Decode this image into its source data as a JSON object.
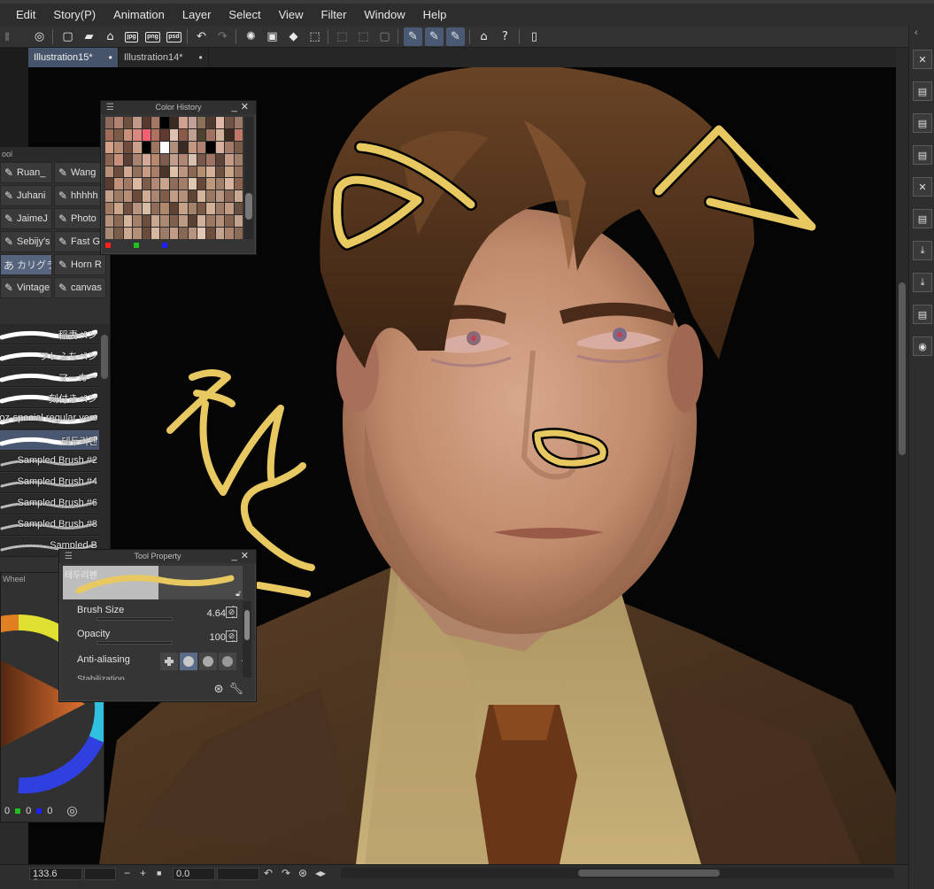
{
  "menu": [
    "Edit",
    "Story(P)",
    "Animation",
    "Layer",
    "Select",
    "View",
    "Filter",
    "Window",
    "Help"
  ],
  "toolbar": {
    "icons": [
      "clip-studio-icon",
      "new-icon",
      "open-icon",
      "save-icon",
      "export-jpg-icon",
      "export-png-icon",
      "export-psd-icon",
      "undo-icon",
      "redo-icon",
      "loading-icon",
      "transform-icon",
      "fill-icon",
      "clear-selection-icon",
      "crop-icon",
      "invert-icon",
      "stabilize-icon",
      "pen-pressure-icon",
      "ruler-icon",
      "learn-icon",
      "help-icon",
      "companion-icon"
    ],
    "mini_labels": {
      "jpg": "jpg",
      "png": "png",
      "psd": "psd"
    }
  },
  "tabs": [
    {
      "label": "Illustration15*",
      "active": true
    },
    {
      "label": "Illustration14*",
      "active": false
    }
  ],
  "color_history": {
    "title": "Color History",
    "swatches": [
      "#8a6a5a",
      "#b08070",
      "#6e5040",
      "#c09a88",
      "#5a3a30",
      "#a47864",
      "#000000",
      "#3a2a20",
      "#d0a090",
      "#c0a098",
      "#8c7058",
      "#4e3a2e",
      "#e0b8a8",
      "#705446",
      "#9a7a66",
      "#a06c58",
      "#7c5a48",
      "#c89078",
      "#d88880",
      "#f06070",
      "#b07060",
      "#603a30",
      "#e0c0b0",
      "#8a5a48",
      "#c0a090",
      "#504030",
      "#a07060",
      "#d0b098",
      "#3a2a20",
      "#c07868",
      "#d4a088",
      "#b88c74",
      "#704c3c",
      "#caa08c",
      "#000000",
      "#9c7460",
      "#ffffff",
      "#b0907c",
      "#3a2a24",
      "#c49880",
      "#b08070",
      "#000000",
      "#d8b0a0",
      "#a27c68",
      "#7a5a48",
      "#8a6450",
      "#c8907c",
      "#5a4034",
      "#a88270",
      "#d4a898",
      "#b88870",
      "#7c5c4c",
      "#c0a08c",
      "#ae8672",
      "#d8c0b0",
      "#785848",
      "#a07464",
      "#5c4438",
      "#c49c88",
      "#a0806c",
      "#b89078",
      "#6c4c3c",
      "#d0a890",
      "#90705c",
      "#c89c84",
      "#a87e68",
      "#4c3428",
      "#e0c0a8",
      "#bc9480",
      "#8c6854",
      "#b49070",
      "#d4b098",
      "#6e5040",
      "#caa488",
      "#987460",
      "#5a3c30",
      "#c09078",
      "#a07864",
      "#d8b8a0",
      "#7c5c48",
      "#b08874",
      "#c8a48c",
      "#8e6e58",
      "#a47c68",
      "#e0c8b0",
      "#684838",
      "#bc987c",
      "#a0806a",
      "#d8b4a0",
      "#8c6450",
      "#c4a08a",
      "#9c7a64",
      "#b88e76",
      "#6a4a38",
      "#d0ac94",
      "#a88670",
      "#7e5e4a",
      "#c29c84",
      "#b4907a",
      "#604434",
      "#d4b49c",
      "#987864",
      "#ba9682",
      "#8a6a56",
      "#c8a890",
      "#a07a60",
      "#cca48a",
      "#705040",
      "#b89480",
      "#d8bca4",
      "#8e6c58",
      "#b0886e",
      "#5e4232",
      "#c6a288",
      "#a4826c",
      "#7a5a46",
      "#d2b098",
      "#9e7c66",
      "#c09a82",
      "#685040",
      "#b6927c",
      "#8a6a54",
      "#d4b49a",
      "#a2806a",
      "#6c4e3e",
      "#c8a690",
      "#aa8872",
      "#7e604c",
      "#bc9a84",
      "#5a4030",
      "#d0b09a",
      "#9a7862",
      "#b48e78",
      "#846450",
      "#c2a28c",
      "#a88a74",
      "#7a5c48",
      "#cca890",
      "#b29078",
      "#6a4c3a",
      "#d6b8a0",
      "#9c7c66",
      "#c09c86",
      "#886852",
      "#b69480",
      "#e2c8b4",
      "#704e3e",
      "#c4a48e",
      "#a8846e",
      "#8c6c58"
    ],
    "foot_colors": [
      "#ff2020",
      "#20c020",
      "#2020ff"
    ]
  },
  "subtool": {
    "header": "ool",
    "items": [
      {
        "label": "Ruan_",
        "icon": "pen-icon",
        "col": 0,
        "row": 0,
        "active": false
      },
      {
        "label": "Wang",
        "icon": "pen-icon",
        "col": 1,
        "row": 0,
        "active": false
      },
      {
        "label": "Juhani",
        "icon": "pen-icon",
        "col": 0,
        "row": 1,
        "active": false
      },
      {
        "label": "hhhhh",
        "icon": "pen-icon",
        "col": 1,
        "row": 1,
        "active": false
      },
      {
        "label": "JaimeJ",
        "icon": "pen-icon",
        "col": 0,
        "row": 2,
        "active": false
      },
      {
        "label": "Photo",
        "icon": "pen-icon",
        "col": 1,
        "row": 2,
        "active": false
      },
      {
        "label": "Sebijy's",
        "icon": "pen-icon",
        "col": 0,
        "row": 3,
        "active": false
      },
      {
        "label": "Fast G",
        "icon": "pen-icon",
        "col": 1,
        "row": 3,
        "active": false
      },
      {
        "label": "カリグラ",
        "icon": "calligraphy-icon",
        "col": 0,
        "row": 4,
        "active": true
      },
      {
        "label": "Horn R",
        "icon": "pen-icon",
        "col": 1,
        "row": 4,
        "active": false
      },
      {
        "label": "Vintage",
        "icon": "pen-icon",
        "col": 0,
        "row": 5,
        "active": false
      },
      {
        "label": "canvas",
        "icon": "pen-icon",
        "col": 1,
        "row": 5,
        "active": false
      }
    ],
    "brushes": [
      {
        "label": "稲妻ペン",
        "active": false
      },
      {
        "label": "フレふちペン",
        "active": false
      },
      {
        "label": "マーカー",
        "active": false
      },
      {
        "label": "刻付きペン",
        "active": false
      },
      {
        "label": "roz-special regular vers",
        "active": false
      },
      {
        "label": "테두리펜",
        "active": true
      },
      {
        "label": "Sampled Brush #2",
        "active": false
      },
      {
        "label": "Sampled Brush #4",
        "active": false
      },
      {
        "label": "Sampled Brush #6",
        "active": false
      },
      {
        "label": "Sampled Brush #8",
        "active": false
      },
      {
        "label": "Sampled B",
        "active": false
      }
    ]
  },
  "color_wheel": {
    "title": "Wheel",
    "values": [
      "0",
      "0",
      "0"
    ],
    "value_colors": [
      "#ff2020",
      "#20c020",
      "#2020ff"
    ]
  },
  "tool_property": {
    "title": "Tool Property",
    "brush_name": "테두리펜",
    "stroke_color": "#e8c860",
    "brush_size_label": "Brush Size",
    "brush_size_value": "4.64",
    "opacity_label": "Opacity",
    "opacity_value": "100",
    "aa_label": "Anti-aliasing",
    "stabilization_label": "Stabilization"
  },
  "bottom": {
    "zoom": "133.6",
    "angle": "0.0"
  },
  "right_panel": {
    "icons": [
      "close-x-icon",
      "layer-icon",
      "layer-icon",
      "layer-icon",
      "delete-icon",
      "layer-icon",
      "import-icon",
      "import-icon",
      "layer-icon",
      "camera-icon"
    ]
  },
  "colors": {
    "doodle": "#e8c860",
    "doodle_outline": "#000000",
    "accent": "#4a5a74"
  }
}
